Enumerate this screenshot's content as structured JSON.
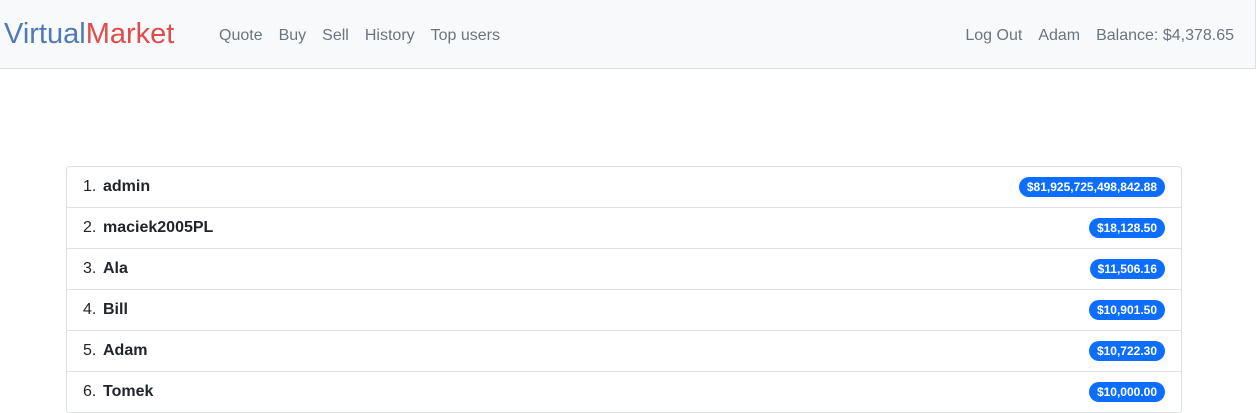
{
  "navbar": {
    "brand_part1": "Virtual",
    "brand_part2": "Market",
    "links_left": [
      "Quote",
      "Buy",
      "Sell",
      "History",
      "Top users"
    ],
    "logout": "Log Out",
    "username": "Adam",
    "balance": "Balance: $4,378.65"
  },
  "top_users": [
    {
      "rank": "1.",
      "name": "admin",
      "balance": "$81,925,725,498,842.88"
    },
    {
      "rank": "2.",
      "name": "maciek2005PL",
      "balance": "$18,128.50"
    },
    {
      "rank": "3.",
      "name": "Ala",
      "balance": "$11,506.16"
    },
    {
      "rank": "4.",
      "name": "Bill",
      "balance": "$10,901.50"
    },
    {
      "rank": "5.",
      "name": "Adam",
      "balance": "$10,722.30"
    },
    {
      "rank": "6.",
      "name": "Tomek",
      "balance": "$10,000.00"
    }
  ],
  "colors": {
    "brand_blue": "#4f7ab5",
    "brand_red": "#e04b4b",
    "badge": "#0d6efd"
  }
}
